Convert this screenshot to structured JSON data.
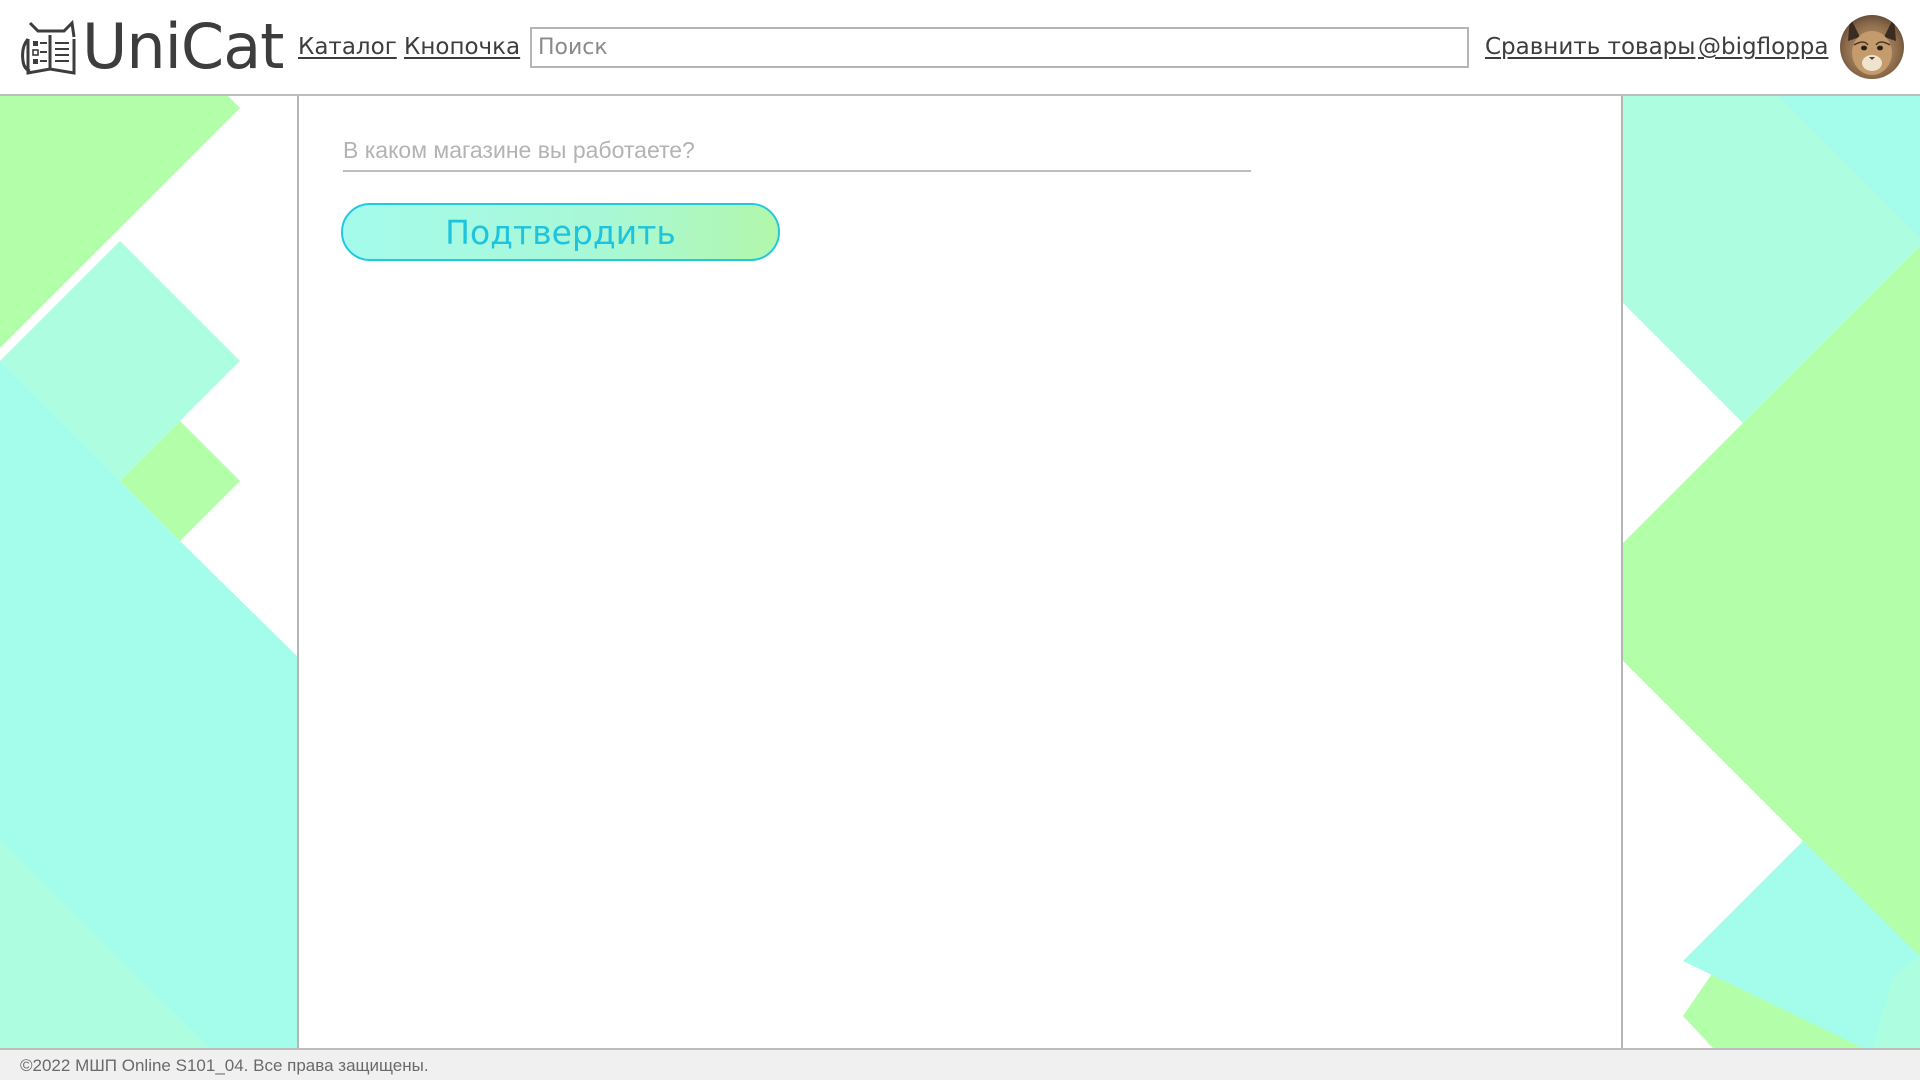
{
  "header": {
    "logo_text": "UniCat",
    "nav": {
      "catalog": "Каталог",
      "button": "Кнопочка"
    },
    "search": {
      "placeholder": "Поиск",
      "value": ""
    },
    "compare_label": "Сравнить товары",
    "username": "@bigfloppa",
    "avatar_icon": "avatar-caracal"
  },
  "form": {
    "store_placeholder": "В каком магазине вы работаете?",
    "store_value": "",
    "confirm_label": "Подтвердить"
  },
  "footer": {
    "copyright": "©2022 МШП Online S101_04. Все права защищены."
  },
  "colors": {
    "mint": "#a7fdec",
    "teal": "#a1fbeb",
    "green": "#b2fea9",
    "button_border": "#22c8e0",
    "button_text": "#1ec4dd",
    "text": "#3d3d3d"
  }
}
